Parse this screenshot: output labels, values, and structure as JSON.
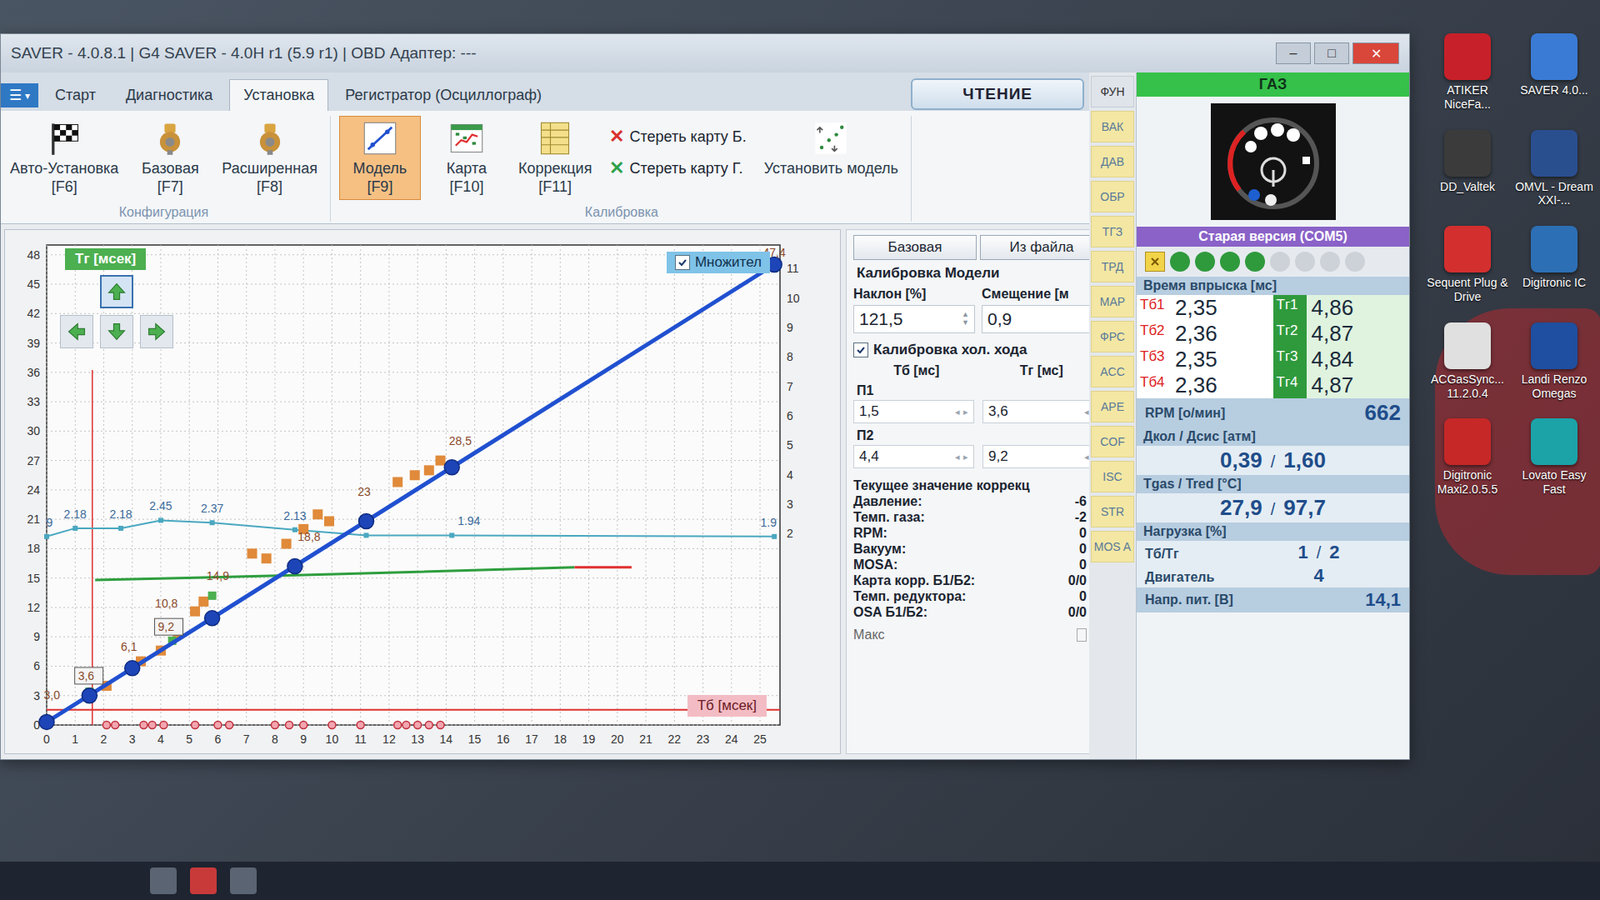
{
  "window": {
    "title": "SAVER - 4.0.8.1 | G4 SAVER - 4.0H r1 (5.9 r1) | OBD Адаптер: ---",
    "controls": [
      "–",
      "□",
      "✕"
    ]
  },
  "menu_button": [
    "☰",
    "▾"
  ],
  "tabs": [
    {
      "label": "Старт",
      "selected": false
    },
    {
      "label": "Диагностика",
      "selected": false
    },
    {
      "label": "Установка",
      "selected": true
    },
    {
      "label": "Регистратор (Осциллограф)",
      "selected": false
    }
  ],
  "read_button": "ЧТЕНИЕ",
  "ribbon": {
    "groups": [
      {
        "label": "Конфигурация",
        "items": [
          {
            "label": "Авто-Установка",
            "key": "[F6]",
            "kind": "flag",
            "selected": false
          },
          {
            "label": "Базовая",
            "key": "[F7]",
            "kind": "config",
            "selected": false
          },
          {
            "label": "Расширенная",
            "key": "[F8]",
            "kind": "config",
            "selected": false
          }
        ]
      },
      {
        "label": "Калибровка",
        "items": [
          {
            "label": "Модель",
            "key": "[F9]",
            "kind": "model",
            "selected": true
          },
          {
            "label": "Карта",
            "key": "[F10]",
            "kind": "map",
            "selected": false
          },
          {
            "label": "Коррекция",
            "key": "[F11]",
            "kind": "table",
            "selected": false
          }
        ]
      }
    ],
    "actions": [
      {
        "mark": "✕",
        "label": "Стереть карту Б.",
        "color": "#d9302c"
      },
      {
        "mark": "✕",
        "label": "Стереть карту Г.",
        "color": "#2ea04a"
      }
    ],
    "install": "Установить модель"
  },
  "chart": {
    "y_label": "Tг [мсек]",
    "x_label": "Тб [мсек]",
    "multiplier_toggle": {
      "label": "Множител",
      "checked": true
    },
    "nav": [
      {
        "dir": "up",
        "selected": true
      },
      {
        "dir": "left",
        "selected": false
      },
      {
        "dir": "down",
        "selected": false
      },
      {
        "dir": "right",
        "selected": false
      }
    ],
    "y_ticks": [
      "0",
      "3",
      "6",
      "9",
      "12",
      "15",
      "18",
      "21",
      "24",
      "27",
      "30",
      "33",
      "36",
      "39",
      "42",
      "45",
      "48"
    ],
    "x_ticks": [
      "0",
      "1",
      "2",
      "3",
      "4",
      "5",
      "6",
      "7",
      "8",
      "9",
      "10",
      "11",
      "12",
      "13",
      "14",
      "15",
      "16",
      "17",
      "18",
      "19",
      "20",
      "21",
      "22",
      "23",
      "24",
      "25"
    ],
    "y2_ticks": [
      "2",
      "3",
      "4",
      "5",
      "6",
      "7",
      "8",
      "9",
      "10",
      "11"
    ],
    "model_line": {
      "x": [
        0,
        25.5
      ],
      "y": [
        0.3,
        47.0
      ]
    },
    "model_nodes": {
      "x": [
        0,
        1.5,
        3,
        5.8,
        8.7,
        11.2,
        14.2,
        25.5
      ],
      "y": [
        0.3,
        3.0,
        5.8,
        10.9,
        16.2,
        20.8,
        26.3,
        47.0
      ]
    },
    "samples": {
      "x": [
        2.1,
        3.3,
        4.0,
        4.6,
        5.2,
        5.5,
        7.2,
        7.7,
        8.4,
        9.0,
        9.5,
        9.9,
        12.3,
        12.9,
        13.4,
        13.8
      ],
      "y": [
        4.0,
        6.5,
        7.6,
        9.3,
        11.6,
        12.6,
        17.5,
        17.0,
        18.5,
        20.0,
        21.5,
        20.8,
        24.8,
        25.5,
        26.0,
        27.0
      ]
    },
    "green_samples": {
      "x": [
        1.5,
        4.4,
        5.8
      ],
      "y": [
        3.4,
        8.6,
        13.2
      ]
    },
    "multiplier": {
      "x": [
        0,
        1,
        2.6,
        4,
        5.8,
        8.7,
        11.2,
        14.2,
        25.5
      ],
      "y": [
        1.9,
        2.18,
        2.18,
        2.45,
        2.37,
        2.13,
        1.94,
        1.94,
        1.9
      ]
    },
    "multiplier_labels": [
      {
        "text": "9",
        "x": 0.1,
        "y": 1.9
      },
      {
        "text": "2.18",
        "x": 1,
        "y": 2.18
      },
      {
        "text": "2.18",
        "x": 2.6,
        "y": 2.18
      },
      {
        "text": "2.45",
        "x": 4,
        "y": 2.45
      },
      {
        "text": "2.37",
        "x": 5.8,
        "y": 2.37
      },
      {
        "text": "2.13",
        "x": 8.7,
        "y": 2.13
      },
      {
        "text": "1.94",
        "x": 14.8,
        "y": 1.94
      },
      {
        "text": "1.9",
        "x": 25.3,
        "y": 1.9
      }
    ],
    "green_line": {
      "x": [
        1.7,
        9,
        18.5
      ],
      "y": [
        14.8,
        15.3,
        16.1
      ]
    },
    "red_line": {
      "x": [
        18.5,
        20.5
      ],
      "y": [
        16.1,
        16.1
      ]
    },
    "cursor_x": 1.6,
    "floor_y": 1.55,
    "petrol_marks": {
      "x": [
        2.1,
        2.4,
        3.4,
        3.7,
        4.1,
        5.2,
        6.0,
        6.4,
        8.0,
        8.5,
        9.0,
        10.0,
        11.0,
        12.3,
        12.6,
        13.0,
        13.4,
        13.8
      ]
    },
    "point_labels": [
      {
        "text": "3,0",
        "x": -0.1,
        "y": 2.6,
        "boxed": false
      },
      {
        "text": "3,6",
        "x": 1.1,
        "y": 4.6,
        "boxed": true
      },
      {
        "text": "6,1",
        "x": 2.6,
        "y": 7.6,
        "boxed": false
      },
      {
        "text": "9,2",
        "x": 3.9,
        "y": 9.6,
        "boxed": true
      },
      {
        "text": "10,8",
        "x": 3.8,
        "y": 12.0,
        "boxed": false
      },
      {
        "text": "14,9",
        "x": 5.6,
        "y": 14.8,
        "boxed": false
      },
      {
        "text": "18,8",
        "x": 8.8,
        "y": 18.8,
        "boxed": false
      },
      {
        "text": "23",
        "x": 10.9,
        "y": 23.4,
        "boxed": false
      },
      {
        "text": "28,5",
        "x": 14.1,
        "y": 28.6,
        "boxed": false
      },
      {
        "text": "47,4",
        "x": 25.1,
        "y": 47.8,
        "boxed": false
      }
    ]
  },
  "calibration": {
    "buttons": [
      {
        "label": "Базовая",
        "selected": false
      },
      {
        "label": "Из файла",
        "selected": false
      }
    ],
    "title": "Калибровка Модели",
    "fields": [
      {
        "label": "Наклон [%]",
        "value": "121,5"
      },
      {
        "label": "Смещение [м",
        "value": "0,9"
      }
    ],
    "spin_vertical": [
      "▲",
      "▼"
    ],
    "idle": {
      "label": "Калибровка хол. хода",
      "checked": true
    },
    "columns": [
      "Тб [мс]",
      "Тг [мс]"
    ],
    "points": [
      {
        "label": "П1",
        "petrol": "1,5",
        "gas": "3,6"
      },
      {
        "label": "П2",
        "petrol": "4,4",
        "gas": "9,2"
      }
    ],
    "spin_horizontal": [
      "◂",
      "▸"
    ]
  },
  "corrections": {
    "title": "Текущее значение коррекц",
    "rows": [
      {
        "label": "Давление:",
        "value": "-6"
      },
      {
        "label": "Темп. газа:",
        "value": "-2"
      },
      {
        "label": "RPM:",
        "value": "0"
      },
      {
        "label": "Вакуум:",
        "value": "0"
      },
      {
        "label": "MOSA:",
        "value": "0"
      },
      {
        "label": "Карта корр. Б1/Б2:",
        "value": "0/0"
      },
      {
        "label": "Темп. редуктора:",
        "value": "0"
      },
      {
        "label": "OSA Б1/Б2:",
        "value": "0/0"
      }
    ],
    "max_label": "Макс"
  },
  "side_buttons": [
    "ФУН",
    "ВАК",
    "ДАВ",
    "ОБР",
    "ТГЗ",
    "ТРД",
    "MAP",
    "ФРС",
    "ACC",
    "APE",
    "COF",
    "ISC",
    "STR",
    "MOS A"
  ],
  "status": {
    "fuel": "ГАЗ",
    "version": "Старая версия (COM5)",
    "indicators": [
      {
        "kind": "warn",
        "on": true
      },
      {
        "kind": "dot",
        "on": true
      },
      {
        "kind": "dot",
        "on": true
      },
      {
        "kind": "dot",
        "on": true
      },
      {
        "kind": "dot",
        "on": true
      },
      {
        "kind": "dot",
        "on": false
      },
      {
        "kind": "dot",
        "on": false
      },
      {
        "kind": "dot",
        "on": false
      },
      {
        "kind": "dot",
        "on": false
      }
    ],
    "injection": {
      "title": "Время впрыска [мс]",
      "rows": [
        {
          "petrol_label": "Тб1",
          "petrol": "2,35",
          "gas_label": "Тг1",
          "gas": "4,86"
        },
        {
          "petrol_label": "Тб2",
          "petrol": "2,36",
          "gas_label": "Тг2",
          "gas": "4,87"
        },
        {
          "petrol_label": "Тб3",
          "petrol": "2,35",
          "gas_label": "Тг3",
          "gas": "4,84"
        },
        {
          "petrol_label": "Тб4",
          "petrol": "2,36",
          "gas_label": "Тг4",
          "gas": "4,87"
        }
      ]
    },
    "rpm": {
      "label": "RPM [о/мин]",
      "value": "662"
    },
    "pressure": {
      "label": "Дкол / Дсис [атм]",
      "values": [
        "0,39",
        "1,60"
      ],
      "separator": "/"
    },
    "temps": {
      "label": "Tgas / Tred [°C]",
      "values": [
        "27,9",
        "97,7"
      ],
      "separator": "/"
    },
    "load": {
      "label": "Нагрузка [%]",
      "rows": [
        {
          "label": "Тб/Тг",
          "values": [
            "1",
            "2"
          ]
        },
        {
          "label": "Двигатель",
          "values": [
            "4"
          ]
        }
      ],
      "separator": "/"
    },
    "voltage": {
      "label": "Напр. пит. [В]",
      "value": "14,1"
    }
  },
  "desktop_icons": [
    {
      "label": "ATIKER NiceFa...",
      "color": "#c8202a"
    },
    {
      "label": "SAVER 4.0...",
      "color": "#3a7bd5"
    },
    {
      "label": "DD_Valtek",
      "color": "#3b3b3b"
    },
    {
      "label": "OMVL - Dream XXI-...",
      "color": "#2a4f8f"
    },
    {
      "label": "Sequent Plug & Drive",
      "color": "#d32f2f"
    },
    {
      "label": "Digitronic IC",
      "color": "#2d6fb5"
    },
    {
      "label": "ACGasSync... 11.2.0.4",
      "color": "#e0e0e0"
    },
    {
      "label": "Landi Renzo Omegas",
      "color": "#1e4fa0"
    },
    {
      "label": "Digitronic Maxi2.0.5.5",
      "color": "#c62828"
    },
    {
      "label": "Lovato Easy Fast",
      "color": "#1ba3a8"
    }
  ]
}
